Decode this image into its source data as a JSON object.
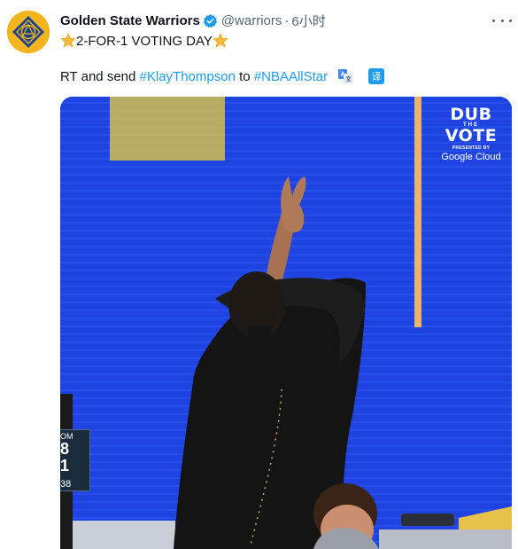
{
  "tweet": {
    "display_name": "Golden State Warriors",
    "handle": "@warriors",
    "separator": "·",
    "time": "6小时",
    "line1_text": "2-FOR-1 VOTING DAY",
    "line2": {
      "prefix": "RT and send ",
      "hashtag1": "#KlayThompson",
      "middle": " to ",
      "hashtag2": "#NBAAllStar"
    },
    "translate_label": "译"
  },
  "media": {
    "overlay": {
      "dub": "DUB",
      "the": "THE",
      "vote": "VOTE",
      "presented": "PRESENTED BY",
      "sponsor": "Google Cloud"
    },
    "scoreboard": {
      "line1": "OM",
      "line2": "8",
      "line3": "1",
      "line4": "38"
    }
  },
  "colors": {
    "accent": "#1d9bf0",
    "avatar_bg": "#f2b51e",
    "avatar_badge": "#1d428a",
    "media_bg": "#1c3fdc"
  },
  "icons": {
    "verified": "verified-badge-icon",
    "star": "star-emoji-icon",
    "translate": "google-translate-icon",
    "more": "more-horizontal-icon"
  }
}
